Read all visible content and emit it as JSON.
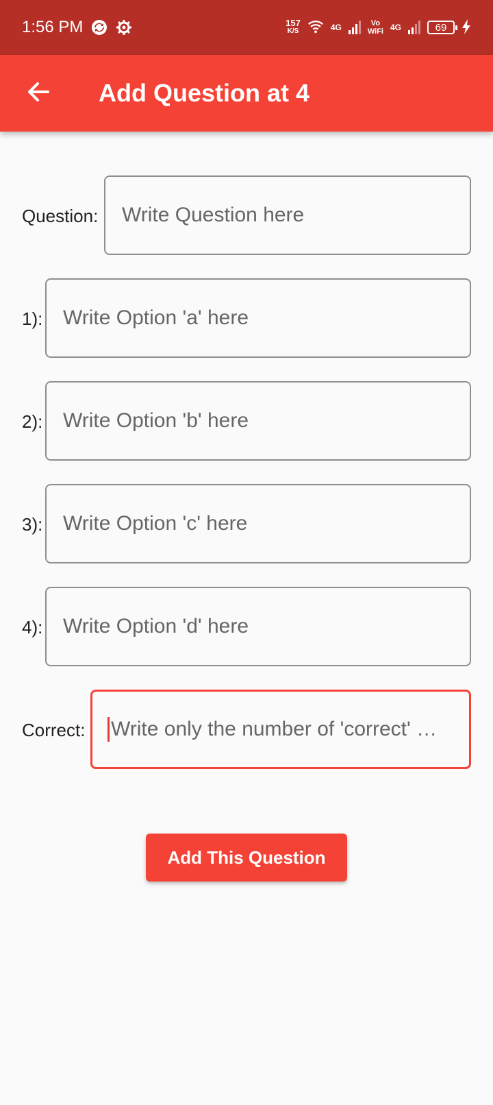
{
  "status_bar": {
    "time": "1:56 PM",
    "net_speed_value": "157",
    "net_speed_unit": "K/S",
    "net1_label": "4G",
    "vowifi_top": "Vo",
    "vowifi_bottom": "WiFi",
    "net2_label": "4G",
    "battery": "69"
  },
  "app_bar": {
    "title": "Add Question at 4"
  },
  "form": {
    "question_label": "Question:",
    "question_placeholder": "Write Question here",
    "option1_label": "1):",
    "option1_placeholder": "Write Option 'a' here",
    "option2_label": "2):",
    "option2_placeholder": "Write Option 'b' here",
    "option3_label": "3):",
    "option3_placeholder": "Write Option 'c' here",
    "option4_label": "4):",
    "option4_placeholder": "Write Option 'd' here",
    "correct_label": "Correct:",
    "correct_placeholder": "Write only the number of 'correct' …"
  },
  "actions": {
    "submit_label": "Add This Question"
  },
  "colors": {
    "status_bar": "#b52f27",
    "app_bar": "#f44336",
    "focus_border": "#f44336",
    "background": "#fafafa"
  }
}
